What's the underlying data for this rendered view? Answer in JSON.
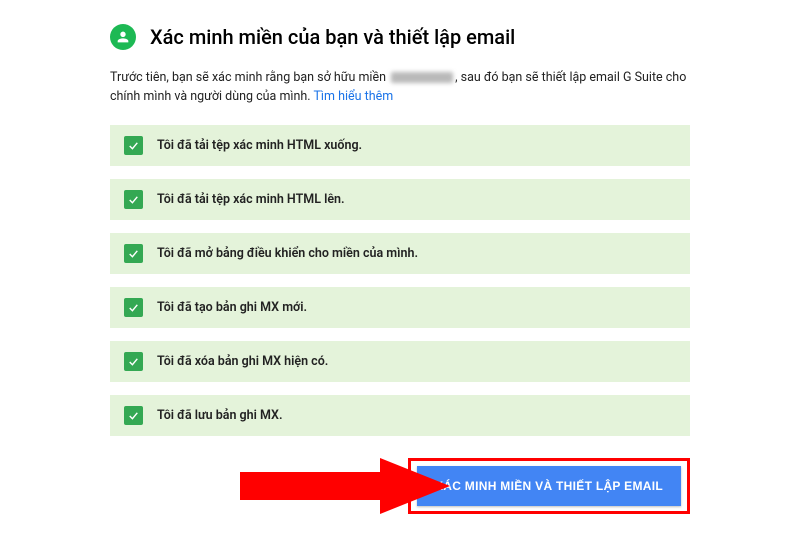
{
  "header": {
    "title": "Xác minh miền của bạn và thiết lập email"
  },
  "intro": {
    "pre": "Trước tiên, bạn sẽ xác minh rằng bạn sở hữu miền ",
    "post": ", sau đó bạn sẽ thiết lập email G Suite cho chính mình và người dùng của mình. ",
    "learn_more": "Tìm hiểu thêm"
  },
  "steps": [
    {
      "label": "Tôi đã tải tệp xác minh HTML xuống."
    },
    {
      "label": "Tôi đã tải tệp xác minh HTML lên."
    },
    {
      "label": "Tôi đã mở bảng điều khiển cho miền của mình."
    },
    {
      "label": "Tôi đã tạo bản ghi MX mới."
    },
    {
      "label": "Tôi đã xóa bản ghi MX hiện có."
    },
    {
      "label": "Tôi đã lưu bản ghi MX."
    }
  ],
  "cta": {
    "label": "XÁC MINH MIỀN VÀ THIẾT LẬP EMAIL"
  }
}
